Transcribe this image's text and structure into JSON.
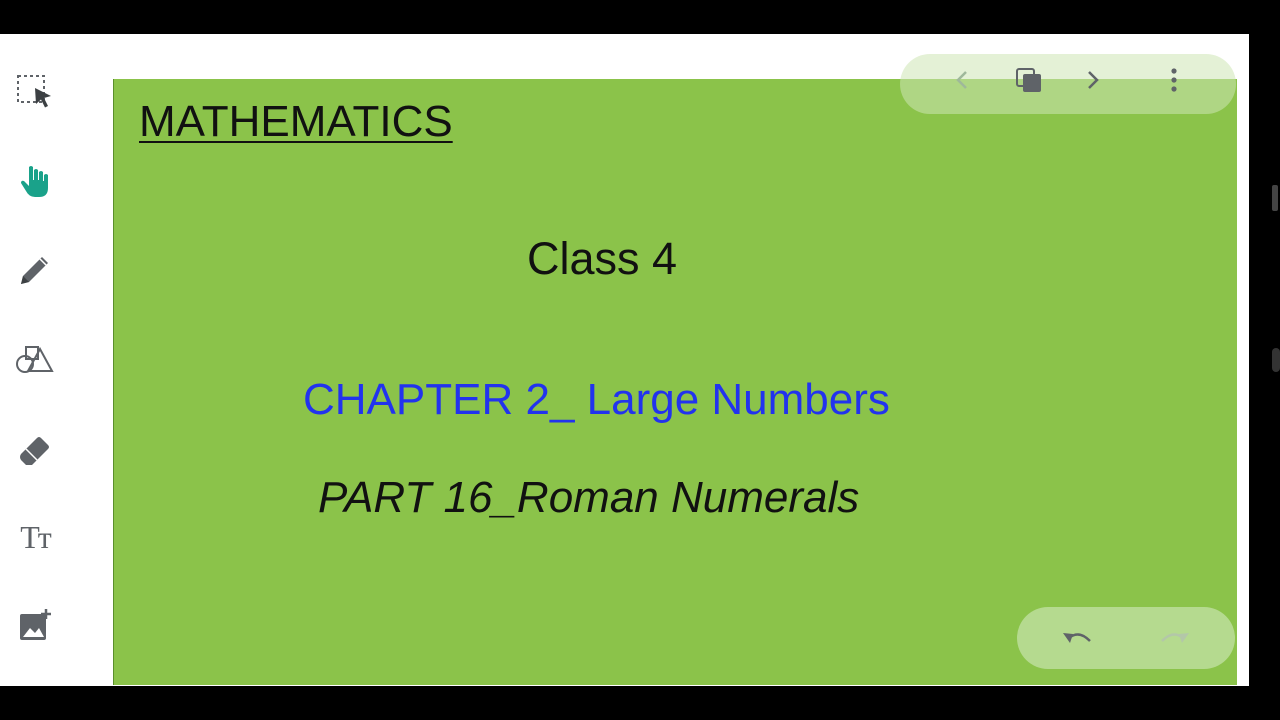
{
  "toolbar": {
    "tools": [
      {
        "icon": "select-icon",
        "active": false
      },
      {
        "icon": "hand-pan-icon",
        "active": true
      },
      {
        "icon": "pen-icon",
        "active": false
      },
      {
        "icon": "shapes-icon",
        "active": false
      },
      {
        "icon": "eraser-icon",
        "active": false
      },
      {
        "icon": "text-icon",
        "active": false
      },
      {
        "icon": "add-image-icon",
        "active": false
      }
    ],
    "text_tool_glyph": "Tт"
  },
  "slide": {
    "title": "MATHEMATICS",
    "class_label": "Class 4",
    "chapter": "CHAPTER 2_ Large Numbers",
    "part": "PART 16_Roman Numerals",
    "background_color": "#8bc34a",
    "chapter_color": "#2233ee"
  },
  "page_controls": {
    "icons": [
      "chevron-left-icon",
      "pages-icon",
      "chevron-right-icon",
      "more-vertical-icon"
    ]
  },
  "history_controls": {
    "icons": [
      "undo-icon",
      "redo-icon"
    ]
  },
  "colors": {
    "accent": "#1aa28a",
    "icon_gray": "#5f6368"
  }
}
